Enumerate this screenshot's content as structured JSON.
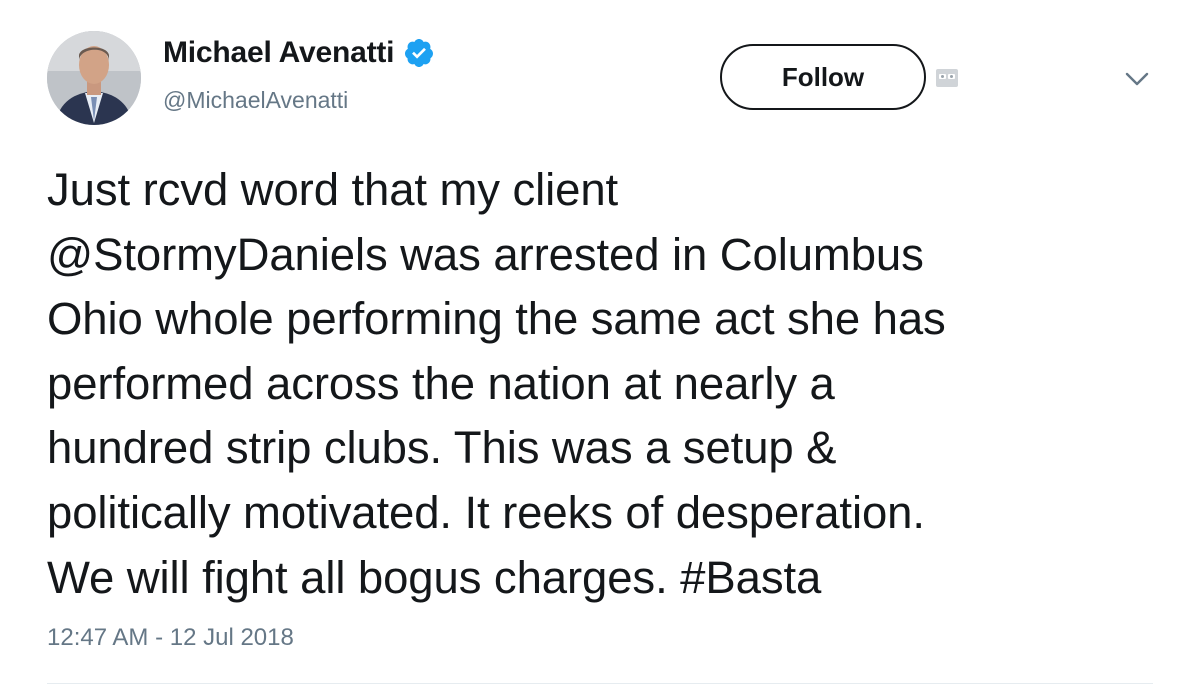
{
  "author": {
    "display_name": "Michael Avenatti",
    "handle": "@MichaelAvenatti",
    "verified": true,
    "verified_color": "#1da1f2"
  },
  "actions": {
    "follow_label": "Follow"
  },
  "icons": {
    "avatar": "profile-photo",
    "verified": "verified-badge-icon",
    "extension": "ghost-icon",
    "menu": "chevron-down-icon"
  },
  "tweet": {
    "text": "Just rcvd word that my client\n@StormyDaniels was arrested in Columbus\nOhio whole performing the same act she has\nperformed across the nation at nearly a\nhundred strip clubs. This was a setup &\npolitically motivated. It reeks of desperation.\nWe will fight all bogus charges. #Basta",
    "timestamp": "12:47 AM - 12 Jul 2018"
  },
  "colors": {
    "text": "#14171a",
    "secondary": "#657786",
    "divider": "#e6ecf0"
  }
}
